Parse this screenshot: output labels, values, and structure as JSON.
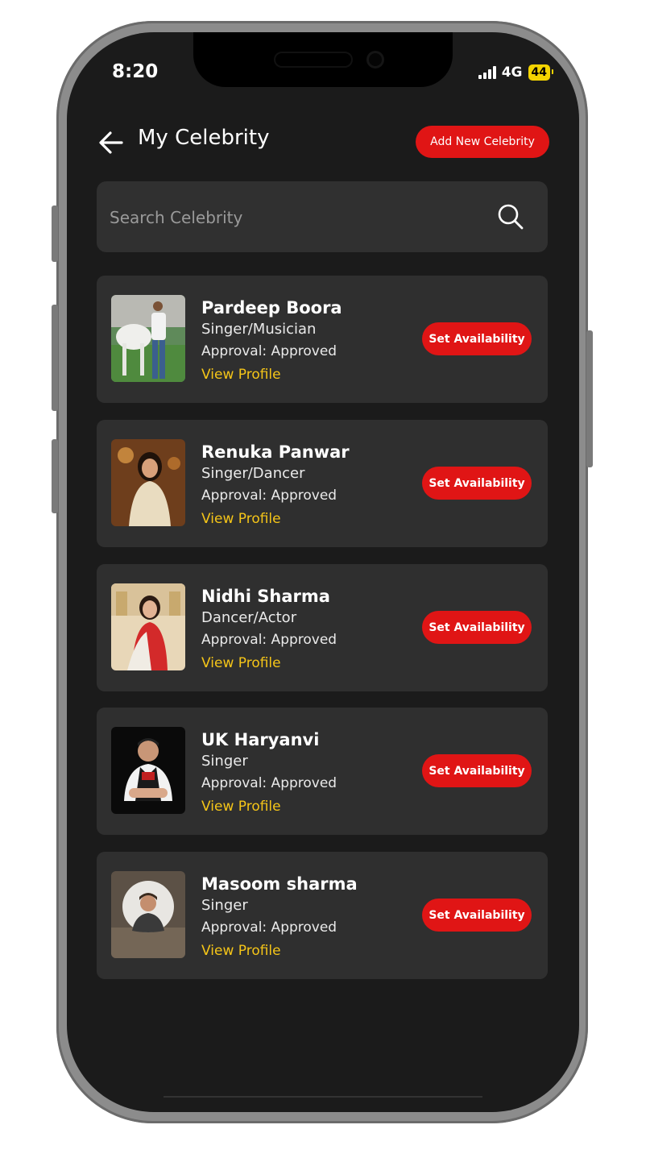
{
  "status_bar": {
    "time": "8:20",
    "network": "4G",
    "battery": "44"
  },
  "header": {
    "title": "My Celebrity",
    "add_button": "Add New Celebrity"
  },
  "search": {
    "placeholder": "Search Celebrity"
  },
  "celebrities": [
    {
      "name": "Pardeep Boora",
      "role": "Singer/Musician",
      "approval": "Approval: Approved",
      "link": "View Profile",
      "button": "Set Availability"
    },
    {
      "name": "Renuka Panwar",
      "role": "Singer/Dancer",
      "approval": "Approval: Approved",
      "link": "View Profile",
      "button": "Set Availability"
    },
    {
      "name": "Nidhi Sharma",
      "role": "Dancer/Actor",
      "approval": "Approval: Approved",
      "link": "View Profile",
      "button": "Set Availability"
    },
    {
      "name": "UK Haryanvi",
      "role": "Singer",
      "approval": "Approval: Approved",
      "link": "View Profile",
      "button": "Set Availability"
    },
    {
      "name": "Masoom sharma",
      "role": "Singer",
      "approval": "Approval: Approved",
      "link": "View Profile",
      "button": "Set Availability"
    }
  ],
  "colors": {
    "accent": "#e01515",
    "link": "#f5c518",
    "background": "#1b1b1b",
    "card": "#2f2f2f"
  }
}
